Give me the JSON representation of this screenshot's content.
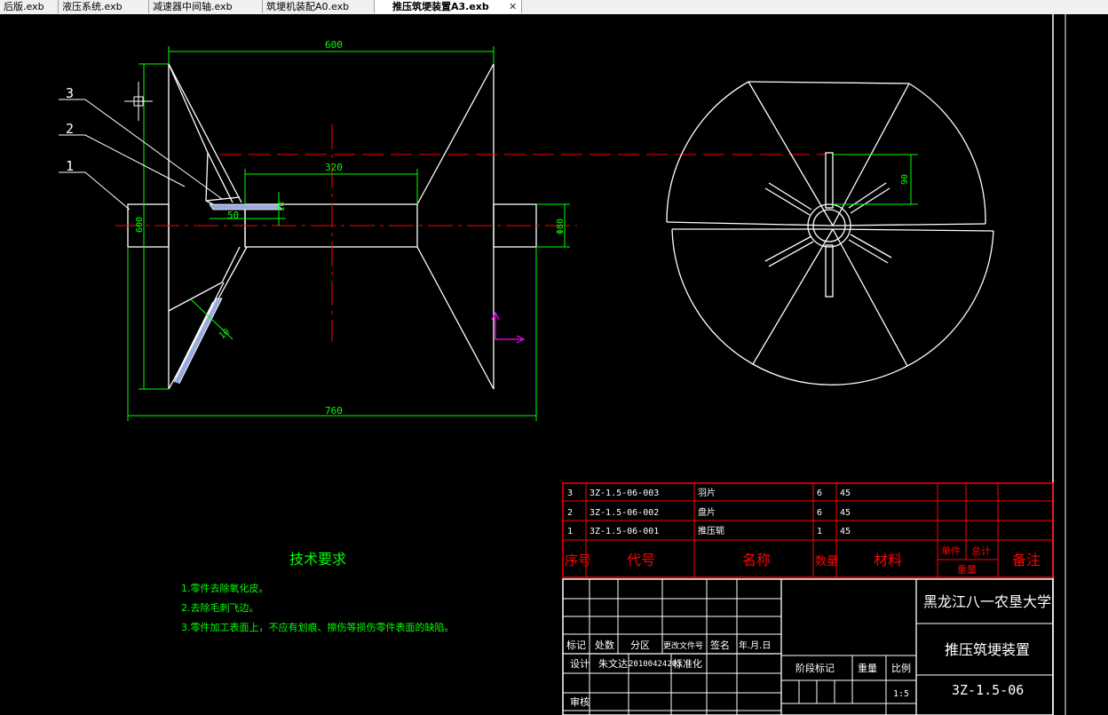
{
  "tabs": [
    {
      "label": "后版.exb"
    },
    {
      "label": "液压系统.exb"
    },
    {
      "label": "减速器中间轴.exb"
    },
    {
      "label": "筑埂机装配A0.exb"
    },
    {
      "label": "推压筑埂装置A3.exb",
      "active": true
    }
  ],
  "colors": {
    "background": "#000000",
    "outline": "#ffffff",
    "dimension": "#00ff00",
    "centerline": "#ff0000",
    "frame": "#ff0000",
    "callout_number": "#ffffff"
  },
  "drawing": {
    "dims": {
      "top": "600",
      "shaft": "320",
      "left_height": "600",
      "small": "10",
      "weld": "50",
      "diameter": "Φ80",
      "overall": "760",
      "angle": "10",
      "blade": "90"
    },
    "callouts": [
      "3",
      "2",
      "1"
    ]
  },
  "tech": {
    "title": "技术要求",
    "items": [
      "1.零件去除氧化皮。",
      "2.去除毛刺飞边。",
      "3.零件加工表面上，不应有划痕、擦伤等损伤零件表面的缺陷。"
    ]
  },
  "bom": {
    "rows": [
      {
        "no": "3",
        "code": "3Z-1.5-06-003",
        "name": "羽片",
        "qty": "6",
        "mat": "45"
      },
      {
        "no": "2",
        "code": "3Z-1.5-06-002",
        "name": "盘片",
        "qty": "6",
        "mat": "45"
      },
      {
        "no": "1",
        "code": "3Z-1.5-06-001",
        "name": "推压轭",
        "qty": "1",
        "mat": "45"
      }
    ],
    "header": {
      "no": "序号",
      "code": "代号",
      "name": "名称",
      "qty": "数量",
      "mat": "材料",
      "single": "单件",
      "total": "总计",
      "weight": "重量",
      "remark": "备注"
    }
  },
  "title_block": {
    "mark": "标记",
    "count": "处数",
    "zone": "分区",
    "doc": "更改文件号",
    "sign": "签名",
    "date": "年.月.日",
    "design": "设计",
    "designer": "朱文达",
    "design_date": "20100424203",
    "standard": "标准化",
    "review": "审核",
    "stage": "阶段标记",
    "weight": "重量",
    "scale": "比例",
    "scale_val": "1:5",
    "school": "黑龙江八一农垦大学",
    "drawing_name": "推压筑埂装置",
    "drawing_code": "3Z-1.5-06"
  }
}
